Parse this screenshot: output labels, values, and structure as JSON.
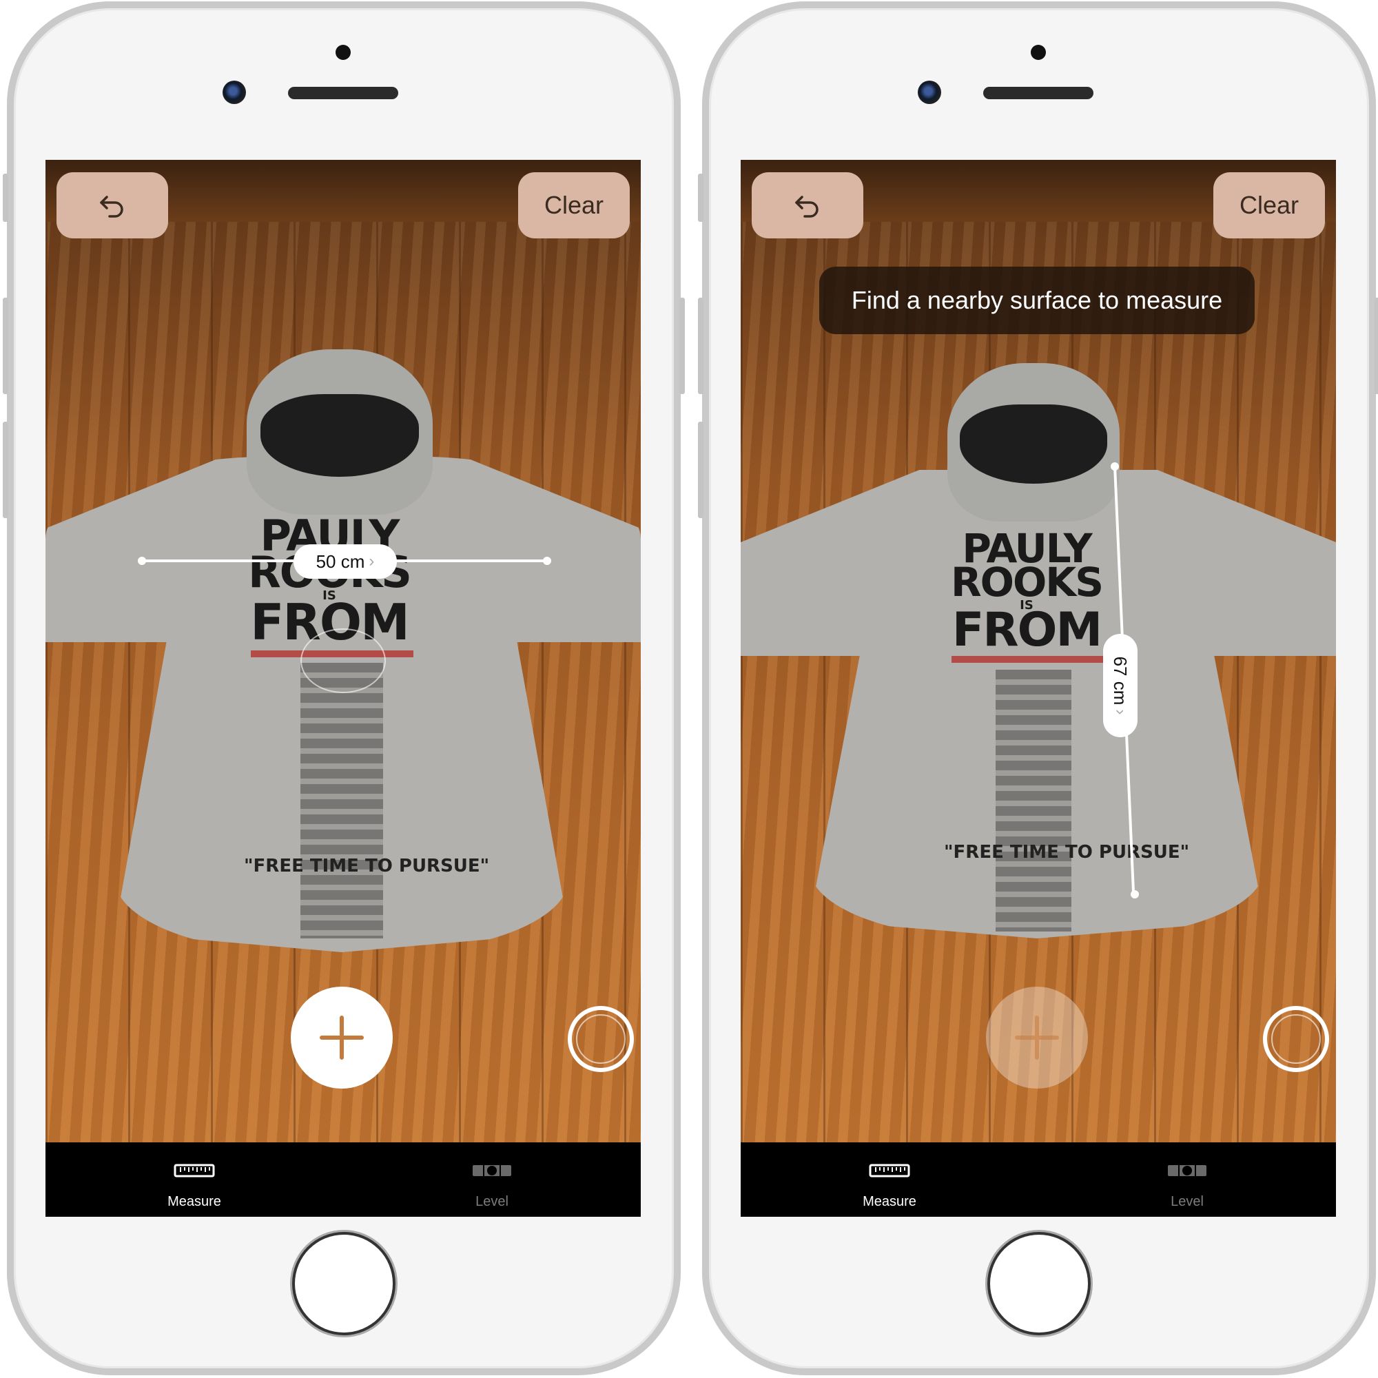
{
  "screens": [
    {
      "undo_icon": "undo-icon",
      "clear_label": "Clear",
      "measurement": {
        "value": "50 cm",
        "orientation": "horizontal"
      },
      "add_button_active": true,
      "tabs": [
        {
          "label": "Measure",
          "icon": "ruler-icon",
          "selected": true
        },
        {
          "label": "Level",
          "icon": "level-icon",
          "selected": false
        }
      ]
    },
    {
      "undo_icon": "undo-icon",
      "clear_label": "Clear",
      "toast": "Find a nearby surface to measure",
      "measurement": {
        "value": "67 cm",
        "orientation": "vertical"
      },
      "add_button_active": false,
      "tabs": [
        {
          "label": "Measure",
          "icon": "ruler-icon",
          "selected": true
        },
        {
          "label": "Level",
          "icon": "level-icon",
          "selected": false
        }
      ]
    }
  ],
  "hoodie_print": {
    "line1": "PAULY",
    "line2": "ROOKS",
    "line3": "IS",
    "line4": "FROM",
    "quote": "\"FREE TIME TO PURSUE\""
  },
  "colors": {
    "button_bg": "#d9b7a4",
    "accent": "#c47a3d",
    "tabbar": "#000000"
  }
}
